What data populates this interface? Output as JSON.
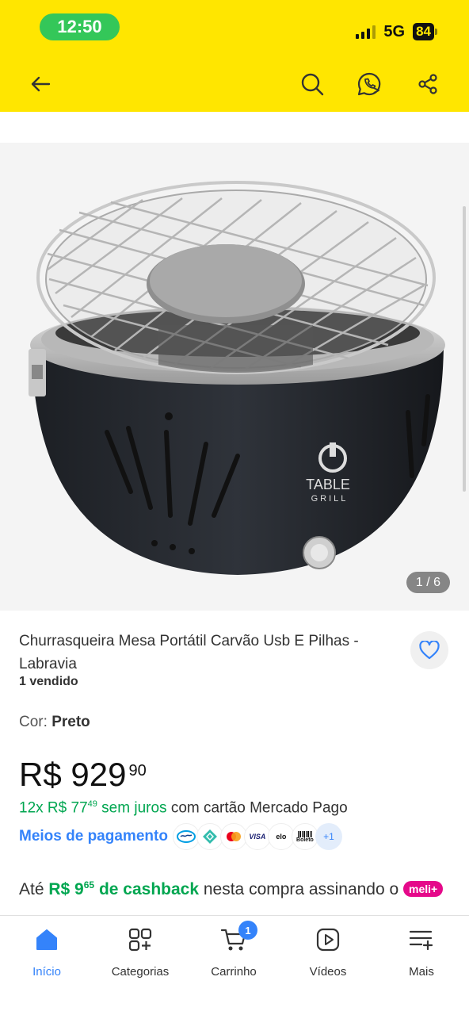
{
  "status_bar": {
    "time": "12:50",
    "network": "5G",
    "battery": "84"
  },
  "header": {
    "icons": [
      "back-arrow-icon",
      "search-icon",
      "whatsapp-share-icon",
      "share-icon"
    ],
    "bg_color": "#FFE600"
  },
  "gallery": {
    "counter": "1 / 6",
    "product_logo_brand": "TABLE",
    "product_logo_sub": "GRILL"
  },
  "product": {
    "title": "Churrasqueira Mesa Portátil Carvão Usb E Pilhas - Labravia",
    "sold": "1 vendido",
    "color_label": "Cor:",
    "color_value": "Preto",
    "price_currency": "R$",
    "price_int": "929",
    "price_cents": "90",
    "installments_count": "12x",
    "installments_currency": "R$",
    "installments_int": "77",
    "installments_cents": "49",
    "installments_interest": "sem juros",
    "installments_suffix": "com cartão Mercado Pago",
    "payment_link": "Meios de pagamento",
    "payment_methods": [
      "mercadopago",
      "pix",
      "mastercard",
      "VISA",
      "elo",
      "Boleto"
    ],
    "payment_more": "+1",
    "cashback_prefix": "Até",
    "cashback_value_int": "R$ 9",
    "cashback_value_cents": "65",
    "cashback_label": "de cashback",
    "cashback_suffix": "nesta compra assinando o",
    "meli_badge": "meli+"
  },
  "bottom_nav": [
    {
      "label": "Início",
      "icon": "home-icon",
      "active": true
    },
    {
      "label": "Categorias",
      "icon": "categories-icon"
    },
    {
      "label": "Carrinho",
      "icon": "cart-icon",
      "badge": "1"
    },
    {
      "label": "Vídeos",
      "icon": "video-icon"
    },
    {
      "label": "Mais",
      "icon": "more-menu-icon"
    }
  ],
  "colors": {
    "accent": "#3483FA",
    "green": "#00A650",
    "meli_pink": "#E5098A"
  }
}
